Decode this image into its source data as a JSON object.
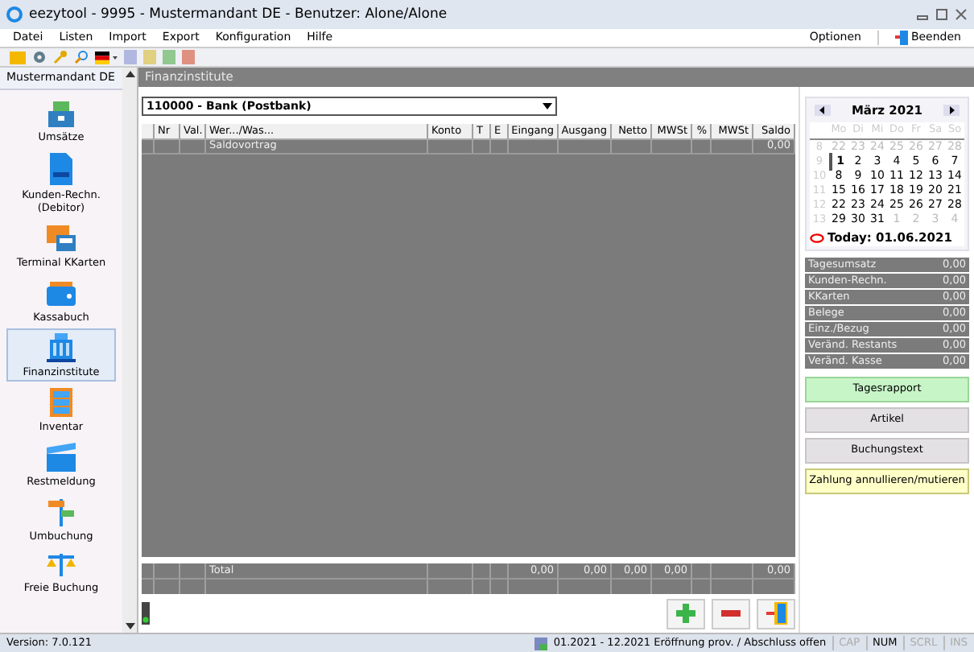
{
  "window": {
    "title": "eezytool - 9995 - Mustermandant DE - Benutzer: Alone/Alone"
  },
  "menu": [
    "Datei",
    "Listen",
    "Import",
    "Export",
    "Konfiguration",
    "Hilfe"
  ],
  "menu_right": {
    "options": "Optionen",
    "quit": "Beenden"
  },
  "sidebar": {
    "title": "Mustermandant DE",
    "items": [
      {
        "label": "Umsätze",
        "selected": false
      },
      {
        "label": "Kunden-Rechn. (Debitor)",
        "selected": false
      },
      {
        "label": "Terminal KKarten",
        "selected": false
      },
      {
        "label": "Kassabuch",
        "selected": false
      },
      {
        "label": "Finanzinstitute",
        "selected": true
      },
      {
        "label": "Inventar",
        "selected": false
      },
      {
        "label": "Restmeldung",
        "selected": false
      },
      {
        "label": "Umbuchung",
        "selected": false
      },
      {
        "label": "Freie Buchung",
        "selected": false
      }
    ]
  },
  "version": "Version: 7.0.121",
  "panel_title": "Finanzinstitute",
  "account_select": {
    "value": "110000 - Bank (Postbank)"
  },
  "table": {
    "columns": [
      "Nr",
      "Val.",
      "Wer.../Was...",
      "Konto",
      "T",
      "E",
      "Eingang",
      "Ausgang",
      "Netto",
      "MWSt",
      "%",
      "MWSt",
      "Saldo"
    ],
    "rows": [
      {
        "wer_was": "Saldovortrag",
        "saldo": "0,00"
      }
    ],
    "total": {
      "label": "Total",
      "eingang": "0,00",
      "ausgang": "0,00",
      "netto": "0,00",
      "mwst": "0,00",
      "saldo": "0,00"
    }
  },
  "calendar": {
    "month": "März 2021",
    "weekdays": [
      "Mo",
      "Di",
      "Mi",
      "Do",
      "Fr",
      "Sa",
      "So"
    ],
    "weeks": [
      {
        "number": "8",
        "days": [
          {
            "day": "22",
            "muted": true,
            "selected": false
          },
          {
            "day": "23",
            "muted": true,
            "selected": false
          },
          {
            "day": "24",
            "muted": true,
            "selected": false
          },
          {
            "day": "25",
            "muted": true,
            "selected": false
          },
          {
            "day": "26",
            "muted": true,
            "selected": false
          },
          {
            "day": "27",
            "muted": true,
            "selected": false
          },
          {
            "day": "28",
            "muted": true,
            "selected": false
          }
        ]
      },
      {
        "number": "9",
        "days": [
          {
            "day": "1",
            "muted": false,
            "selected": true
          },
          {
            "day": "2",
            "muted": false,
            "selected": false
          },
          {
            "day": "3",
            "muted": false,
            "selected": false
          },
          {
            "day": "4",
            "muted": false,
            "selected": false
          },
          {
            "day": "5",
            "muted": false,
            "selected": false
          },
          {
            "day": "6",
            "muted": false,
            "selected": false
          },
          {
            "day": "7",
            "muted": false,
            "selected": false
          }
        ]
      },
      {
        "number": "10",
        "days": [
          {
            "day": "8",
            "muted": false,
            "selected": false
          },
          {
            "day": "9",
            "muted": false,
            "selected": false
          },
          {
            "day": "10",
            "muted": false,
            "selected": false
          },
          {
            "day": "11",
            "muted": false,
            "selected": false
          },
          {
            "day": "12",
            "muted": false,
            "selected": false
          },
          {
            "day": "13",
            "muted": false,
            "selected": false
          },
          {
            "day": "14",
            "muted": false,
            "selected": false
          }
        ]
      },
      {
        "number": "11",
        "days": [
          {
            "day": "15",
            "muted": false,
            "selected": false
          },
          {
            "day": "16",
            "muted": false,
            "selected": false
          },
          {
            "day": "17",
            "muted": false,
            "selected": false
          },
          {
            "day": "18",
            "muted": false,
            "selected": false
          },
          {
            "day": "19",
            "muted": false,
            "selected": false
          },
          {
            "day": "20",
            "muted": false,
            "selected": false
          },
          {
            "day": "21",
            "muted": false,
            "selected": false
          }
        ]
      },
      {
        "number": "12",
        "days": [
          {
            "day": "22",
            "muted": false,
            "selected": false
          },
          {
            "day": "23",
            "muted": false,
            "selected": false
          },
          {
            "day": "24",
            "muted": false,
            "selected": false
          },
          {
            "day": "25",
            "muted": false,
            "selected": false
          },
          {
            "day": "26",
            "muted": false,
            "selected": false
          },
          {
            "day": "27",
            "muted": false,
            "selected": false
          },
          {
            "day": "28",
            "muted": false,
            "selected": false
          }
        ]
      },
      {
        "number": "13",
        "days": [
          {
            "day": "29",
            "muted": false,
            "selected": false
          },
          {
            "day": "30",
            "muted": false,
            "selected": false
          },
          {
            "day": "31",
            "muted": false,
            "selected": false
          },
          {
            "day": "1",
            "muted": true,
            "selected": false
          },
          {
            "day": "2",
            "muted": true,
            "selected": false
          },
          {
            "day": "3",
            "muted": true,
            "selected": false
          },
          {
            "day": "4",
            "muted": true,
            "selected": false
          }
        ]
      }
    ],
    "today": "Today: 01.06.2021"
  },
  "summary": [
    {
      "label": "Tagesumsatz",
      "value": "0,00"
    },
    {
      "label": "Kunden-Rechn.",
      "value": "0,00"
    },
    {
      "label": "KKarten",
      "value": "0,00"
    },
    {
      "label": "Belege",
      "value": "0,00"
    },
    {
      "label": "Einz./Bezug",
      "value": "0,00"
    },
    {
      "label": "Veränd. Restants",
      "value": "0,00"
    },
    {
      "label": "Veränd. Kasse",
      "value": "0,00"
    }
  ],
  "actions": [
    {
      "label": "Tagesrapport",
      "kind": "primary"
    },
    {
      "label": "Artikel",
      "kind": "normal"
    },
    {
      "label": "Buchungstext",
      "kind": "normal"
    },
    {
      "label": "Zahlung annullieren/mutieren",
      "kind": "highlight"
    }
  ],
  "status": {
    "period": "01.2021 - 12.2021 Eröffnung prov. /  Abschluss offen",
    "indicators": [
      {
        "label": "CAP",
        "enabled": false
      },
      {
        "label": "NUM",
        "enabled": true
      },
      {
        "label": "SCRL",
        "enabled": false
      },
      {
        "label": "INS",
        "enabled": false
      }
    ]
  }
}
